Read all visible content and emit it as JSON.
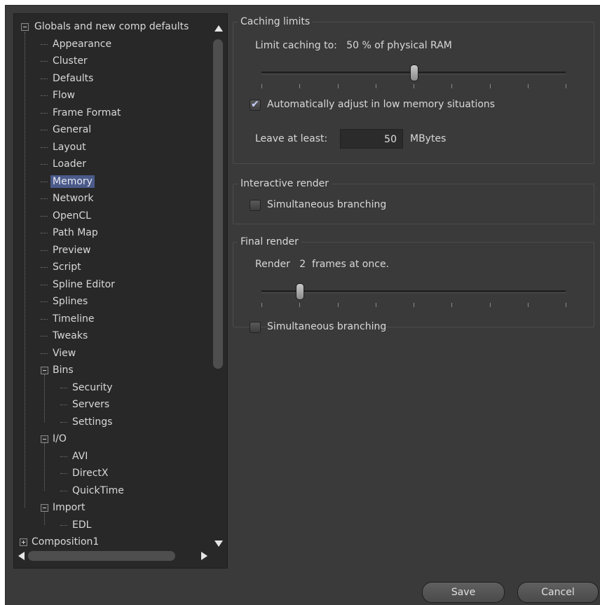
{
  "tree": {
    "root_label": "Globals and new comp defaults",
    "items": [
      "Appearance",
      "Cluster",
      "Defaults",
      "Flow",
      "Frame Format",
      "General",
      "Layout",
      "Loader",
      "Memory",
      "Network",
      "OpenCL",
      "Path Map",
      "Preview",
      "Script",
      "Spline Editor",
      "Splines",
      "Timeline",
      "Tweaks",
      "View"
    ],
    "selected": "Memory",
    "bins": {
      "label": "Bins",
      "children": [
        "Security",
        "Servers",
        "Settings"
      ]
    },
    "io": {
      "label": "I/O",
      "children": [
        "AVI",
        "DirectX",
        "QuickTime"
      ]
    },
    "import": {
      "label": "Import",
      "children": [
        "EDL"
      ]
    },
    "composition_label": "Composition1"
  },
  "caching": {
    "title": "Caching limits",
    "limit_prefix": "Limit caching to:",
    "limit_value": "50",
    "limit_suffix": "% of physical RAM",
    "limit_fraction": 0.5,
    "auto_adjust_label": "Automatically adjust in low memory situations",
    "auto_adjust_checked": true,
    "leave_label": "Leave at least:",
    "leave_value": "50",
    "leave_unit": "MBytes"
  },
  "interactive": {
    "title": "Interactive render",
    "branching_label": "Simultaneous branching",
    "branching_checked": false
  },
  "final": {
    "title": "Final render",
    "render_prefix": "Render",
    "render_value": "2",
    "render_suffix": "frames at once.",
    "render_fraction": 0.125,
    "branching_label": "Simultaneous branching",
    "branching_checked": false
  },
  "buttons": {
    "save": "Save",
    "cancel": "Cancel"
  },
  "icons": {
    "checkmark": "check-icon",
    "scroll_up": "arrow-up-icon",
    "scroll_down": "arrow-down-icon",
    "scroll_left": "arrow-left-icon",
    "scroll_right": "arrow-right-icon"
  },
  "colors": {
    "selection": "#4a5a8a",
    "check": "#c8d0ff"
  }
}
